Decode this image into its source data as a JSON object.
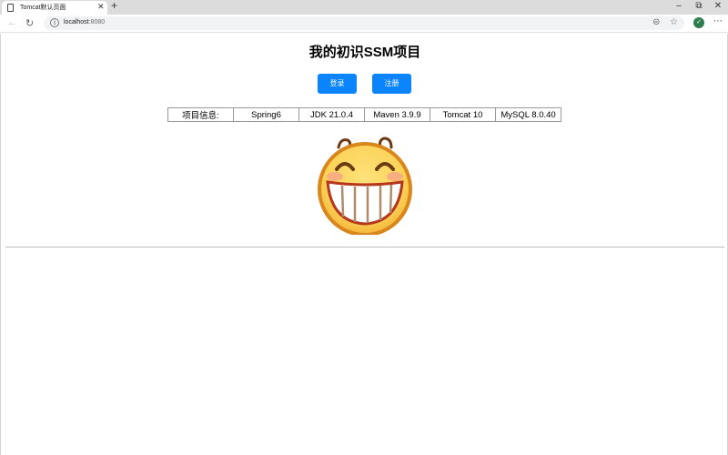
{
  "browser": {
    "tab_title": "Tomcat默认页面",
    "url_host": "localhost",
    "url_port": ":8080"
  },
  "page": {
    "title": "我的初识SSM项目",
    "login_label": "登录",
    "register_label": "注册",
    "info_cells": [
      "项目信息:",
      "Spring6",
      "JDK 21.0.4",
      "Maven 3.9.9",
      "Tomcat 10",
      "MySQL 8.0.40"
    ]
  },
  "icons": {
    "tab": "page-icon",
    "close": "close-icon",
    "new_tab": "plus-icon",
    "minimize": "minimize-icon",
    "restore": "restore-icon",
    "window_close": "close-icon",
    "back": "back-arrow-icon",
    "reload": "reload-icon",
    "site_info": "info-icon",
    "translate": "translate-icon",
    "bookmark": "star-icon",
    "profile": "profile-avatar",
    "emoji": "grinning-smiley"
  },
  "colors": {
    "primary_button": "#0a84ff",
    "smiley_face": "#fbd35a",
    "smiley_outline": "#d9861c"
  }
}
